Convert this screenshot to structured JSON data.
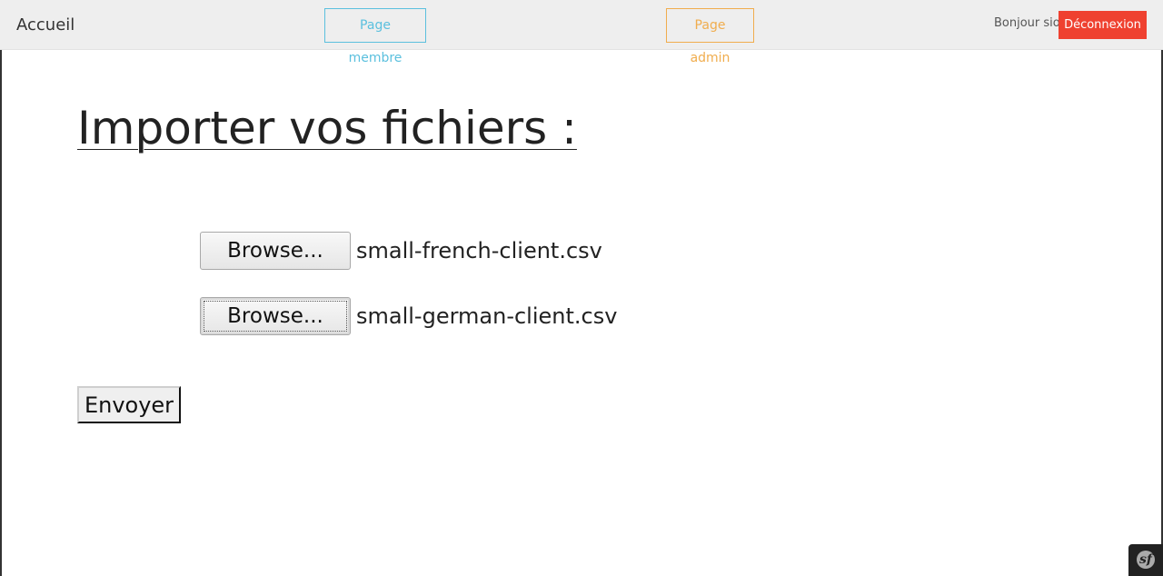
{
  "navbar": {
    "brand": "Accueil",
    "member_page": "Page membre",
    "admin_page": "Page admin",
    "greeting": "Bonjour sio",
    "logout": "Déconnexion"
  },
  "main": {
    "title": "Importer vos fichiers :",
    "files": [
      {
        "button_label": "Browse...",
        "file_name": "small-french-client.csv"
      },
      {
        "button_label": "Browse...",
        "file_name": "small-german-client.csv"
      }
    ],
    "submit_label": "Envoyer"
  },
  "debug_toolbar": {
    "logo_glyph": "sf"
  },
  "colors": {
    "navbar_bg": "#eeeeee",
    "member_accent": "#5bc0de",
    "admin_accent": "#f0ad4e",
    "logout_bg": "#ef4130",
    "toolbar_bg": "#222222"
  },
  "icons": {
    "debug_toolbar": "symfony-logo-icon"
  }
}
